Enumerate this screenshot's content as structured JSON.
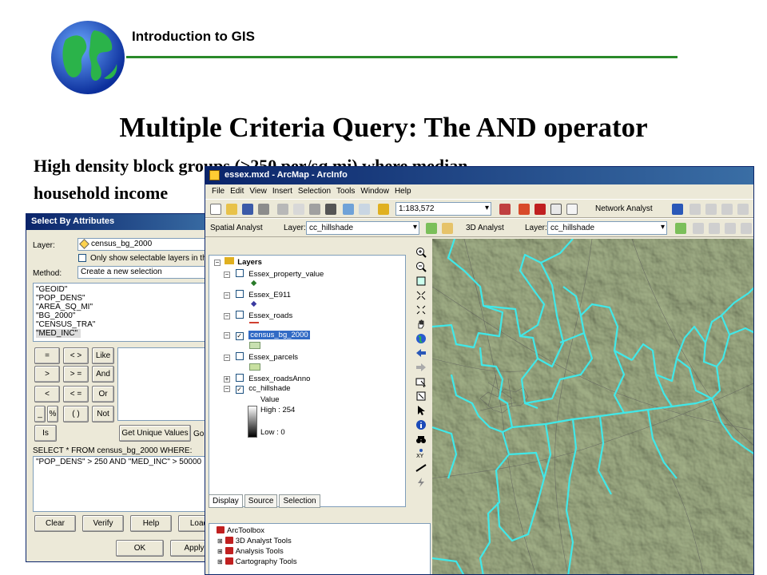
{
  "slide": {
    "course_title": "Introduction to GIS",
    "title": "Multiple Criteria Query: The AND operator",
    "subtitle_line1": "High density block groups (>250 per/sq mi) where median",
    "subtitle_line2": "household income"
  },
  "select_by_attributes": {
    "title": "Select By Attributes",
    "layer_label": "Layer:",
    "layer_value": "census_bg_2000",
    "only_selectable_label": "Only show selectable layers in this list",
    "method_label": "Method:",
    "method_value": "Create a new selection",
    "fields": [
      "\"GEOID\"",
      "\"POP_DENS\"",
      "\"AREA_SQ_MI\"",
      "\"BG_2000\"",
      "\"CENSUS_TRA\"",
      "\"MED_INC\""
    ],
    "operators": {
      "eq": "=",
      "ne": "< >",
      "like": "Like",
      "gt": ">",
      "ge": "> =",
      "and": "And",
      "lt": "<",
      "le": "< =",
      "or": "Or",
      "underscore": "_",
      "percent": "%",
      "parens": "( )",
      "not": "Not",
      "is": "Is"
    },
    "get_unique_values": "Get Unique Values",
    "go_to": "Go",
    "select_from_label": "SELECT * FROM census_bg_2000 WHERE:",
    "query": "\"POP_DENS\" > 250 AND \"MED_INC\" > 50000",
    "buttons": {
      "clear": "Clear",
      "verify": "Verify",
      "help": "Help",
      "load": "Load",
      "ok": "OK",
      "apply": "Apply"
    }
  },
  "arcmap": {
    "title": "essex.mxd - ArcMap - ArcInfo",
    "menu": [
      "File",
      "Edit",
      "View",
      "Insert",
      "Selection",
      "Tools",
      "Window",
      "Help"
    ],
    "scale": "1:183,572",
    "network_analyst": "Network Analyst",
    "spatial_analyst": "Spatial Analyst",
    "layer_label": "Layer:",
    "layer_value": "cc_hillshade",
    "analyst_3d": "3D Analyst",
    "layer_value_2": "cc_hillshade",
    "toc": {
      "root": "Layers",
      "layers": [
        "Essex_property_value",
        "Essex_E911",
        "Essex_roads",
        "census_bg_2000",
        "Essex_parcels",
        "Essex_roadsAnno",
        "cc_hillshade"
      ],
      "value_label": "Value",
      "high": "High : 254",
      "low": "Low : 0"
    },
    "tabs": [
      "Display",
      "Source",
      "Selection"
    ],
    "toolbox": {
      "root": "ArcToolbox",
      "items": [
        "3D Analyst Tools",
        "Analysis Tools",
        "Cartography Tools"
      ]
    }
  },
  "colors": {
    "header_rule": "#2a8a2a",
    "boundary": "#40e8e8",
    "terrain": "#9aa882"
  }
}
